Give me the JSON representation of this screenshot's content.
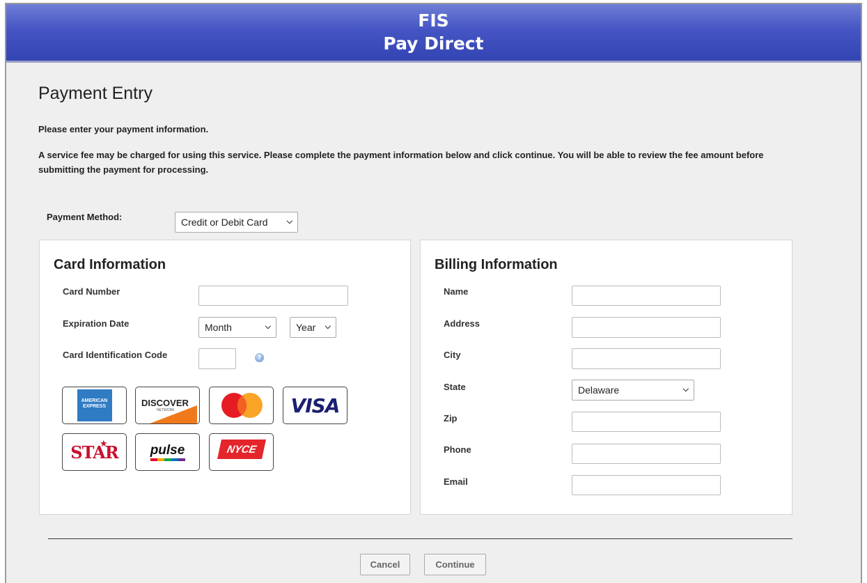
{
  "header": {
    "line1": "FIS",
    "line2": "Pay Direct"
  },
  "page": {
    "title": "Payment Entry",
    "intro": "Please enter your payment information.",
    "fee_note": "A service fee may be charged for using this service. Please complete the payment information below and click continue. You will be able to review the fee amount before submitting the payment for processing."
  },
  "payment_method": {
    "label": "Payment Method:",
    "selected": "Credit or Debit Card"
  },
  "card": {
    "title": "Card Information",
    "number_label": "Card Number",
    "expiration_label": "Expiration Date",
    "month_selected": "Month",
    "year_selected": "Year",
    "cid_label": "Card Identification Code",
    "help_icon": "help-question-icon",
    "logos": {
      "amex": "AMERICAN EXPRESS",
      "discover": "DISCOVER",
      "discover_sub": "NETWORK",
      "visa": "VISA",
      "star": "STAR",
      "pulse": "pulse",
      "nyce": "NYCE"
    }
  },
  "billing": {
    "title": "Billing Information",
    "name_label": "Name",
    "address_label": "Address",
    "city_label": "City",
    "state_label": "State",
    "state_selected": "Delaware",
    "zip_label": "Zip",
    "phone_label": "Phone",
    "email_label": "Email"
  },
  "actions": {
    "cancel": "Cancel",
    "continue": "Continue"
  },
  "colors": {
    "banner": "#4555c3",
    "panel_bg": "#ffffff",
    "page_bg": "#efefef"
  }
}
